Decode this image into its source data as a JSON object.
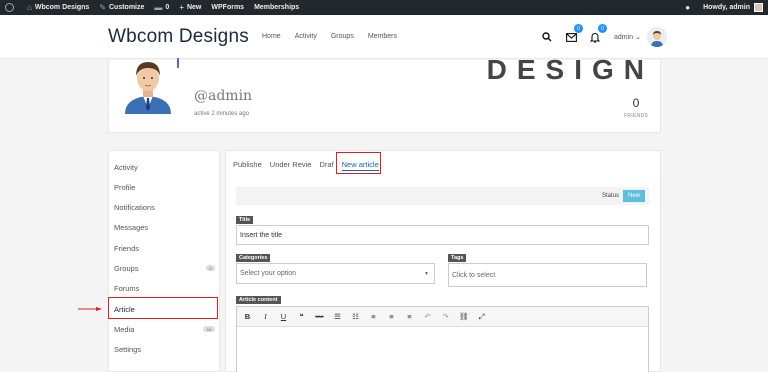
{
  "adminbar": {
    "site_name": "Wbcom Designs",
    "customize": "Customize",
    "comments_count": "0",
    "new_label": "New",
    "wpforms": "WPForms",
    "memberships": "Memberships",
    "howdy": "Howdy, admin"
  },
  "header": {
    "logo": "Wbcom Designs",
    "nav": [
      "Home",
      "Activity",
      "Groups",
      "Members"
    ],
    "messages_badge": "0",
    "notifications_badge": "0",
    "user_label": "admin",
    "chevron": "⌄"
  },
  "profile": {
    "cover_text": "DESIGN",
    "handle": "@admin",
    "active": "active 2 minutes ago",
    "friends_count": "0",
    "friends_label": "FRIENDS"
  },
  "sidebar": {
    "items": [
      {
        "label": "Activity"
      },
      {
        "label": "Profile"
      },
      {
        "label": "Notifications"
      },
      {
        "label": "Messages"
      },
      {
        "label": "Friends"
      },
      {
        "label": "Groups",
        "count": "0"
      },
      {
        "label": "Forums"
      },
      {
        "label": "Article"
      },
      {
        "label": "Media",
        "count": "10"
      },
      {
        "label": "Settings"
      }
    ]
  },
  "main": {
    "tabs": [
      "Publishe",
      "Under Revie",
      "Draf",
      "New article"
    ],
    "status_label": "Status",
    "status_value": "New",
    "title_label": "Title",
    "title_value": "Insert the title",
    "categories_label": "Categories",
    "categories_placeholder": "Select your option",
    "tags_label": "Tags",
    "tags_placeholder": "Click to select",
    "content_label": "Article content",
    "toolbar": [
      "B",
      "I",
      "U",
      "❝",
      "ABC",
      "☰",
      "☷",
      "≡",
      "≡",
      "≡",
      "↶",
      "↷",
      "⛓",
      "⤢"
    ]
  },
  "colors": {
    "accent_blue": "#1e5fb0",
    "status_new": "#5bc0de",
    "highlight_red": "#e02020",
    "adminbar": "#23282d"
  }
}
